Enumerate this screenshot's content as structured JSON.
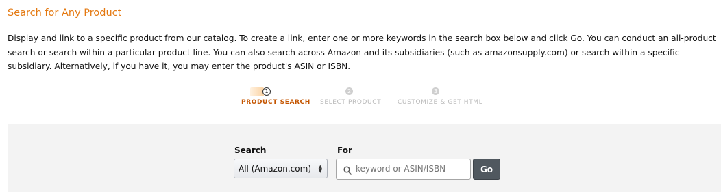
{
  "header": {
    "title": "Search for Any Product",
    "description": "Display and link to a specific product from our catalog. To create a link, enter one or more keywords in the search box below and click Go. You can conduct an all-product search or search within a particular product line. You can also search across Amazon and its subsidiaries (such as amazonsupply.com) or search within a specific subsidiary. Alternatively, if you have it, you may enter the product's ASIN or ISBN."
  },
  "stepper": {
    "steps": [
      {
        "number": "1",
        "label": "PRODUCT SEARCH",
        "state": "active"
      },
      {
        "number": "2",
        "label": "SELECT PRODUCT",
        "state": "inactive"
      },
      {
        "number": "3",
        "label": "CUSTOMIZE & GET HTML",
        "state": "inactive"
      }
    ]
  },
  "search": {
    "search_label": "Search",
    "for_label": "For",
    "scope_value": "All (Amazon.com)",
    "input_value": "",
    "input_placeholder": "keyword or ASIN/ISBN",
    "go_label": "Go",
    "icon": "search-icon"
  },
  "colors": {
    "title": "#e47911",
    "active_step": "#c45500",
    "go_button": "#50585f",
    "panel_background": "#f3f3f3"
  }
}
